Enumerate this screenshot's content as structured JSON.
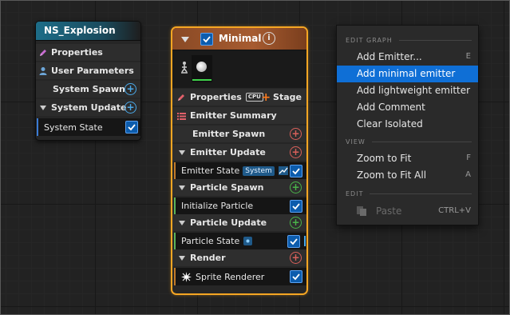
{
  "system_node": {
    "title": "NS_Explosion",
    "properties": "Properties",
    "user_parameters": "User Parameters",
    "system_spawn": "System Spawn",
    "system_update": "System Update",
    "system_state": "System State"
  },
  "emitter_node": {
    "title": "Minimal",
    "properties": "Properties",
    "cpu": "CPU",
    "stage": "Stage",
    "emitter_summary": "Emitter Summary",
    "emitter_spawn": "Emitter Spawn",
    "emitter_update": "Emitter Update",
    "emitter_state": "Emitter State",
    "system_badge": "System",
    "particle_spawn": "Particle Spawn",
    "initialize_particle": "Initialize Particle",
    "particle_update": "Particle Update",
    "particle_state": "Particle State",
    "render": "Render",
    "sprite_renderer": "Sprite Renderer"
  },
  "context_menu": {
    "edit_graph": "EDIT GRAPH",
    "add_emitter": "Add Emitter...",
    "add_emitter_key": "E",
    "add_minimal_emitter": "Add minimal emitter",
    "add_lightweight_emitter": "Add lightweight emitter",
    "add_comment": "Add Comment",
    "clear_isolated": "Clear Isolated",
    "view": "VIEW",
    "zoom_fit": "Zoom to Fit",
    "zoom_fit_key": "F",
    "zoom_fit_all": "Zoom to Fit All",
    "zoom_fit_all_key": "A",
    "edit": "EDIT",
    "paste": "Paste",
    "paste_key": "CTRL+V"
  },
  "colors": {
    "accent": "#0f6fd6",
    "emitter_border": "#f5a623",
    "system_header": "#1d6d88"
  }
}
